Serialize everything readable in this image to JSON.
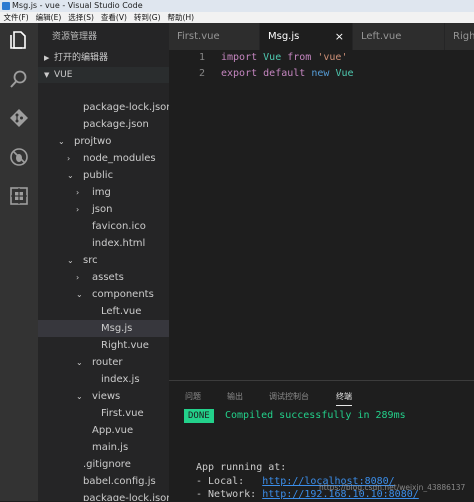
{
  "window": {
    "title": "Msg.js - vue - Visual Studio Code"
  },
  "menu": [
    "文件(F)",
    "编辑(E)",
    "选择(S)",
    "查看(V)",
    "转到(G)",
    "帮助(H)"
  ],
  "activity": [
    {
      "icon": "files-icon"
    },
    {
      "icon": "search-icon"
    },
    {
      "icon": "source-control-icon"
    },
    {
      "icon": "debug-icon"
    },
    {
      "icon": "extensions-icon"
    }
  ],
  "sidebar": {
    "title": "资源管理器",
    "open_editors": "打开的编辑器",
    "workspace": "VUE",
    "tree": [
      {
        "label": "package-lock.json",
        "indent": 1,
        "chev": ""
      },
      {
        "label": "package.json",
        "indent": 1,
        "chev": ""
      },
      {
        "label": "projtwo",
        "indent": 0,
        "chev": "down"
      },
      {
        "label": "node_modules",
        "indent": 1,
        "chev": "right"
      },
      {
        "label": "public",
        "indent": 1,
        "chev": "down"
      },
      {
        "label": "img",
        "indent": 2,
        "chev": "right"
      },
      {
        "label": "json",
        "indent": 2,
        "chev": "right"
      },
      {
        "label": "favicon.ico",
        "indent": 2,
        "chev": ""
      },
      {
        "label": "index.html",
        "indent": 2,
        "chev": ""
      },
      {
        "label": "src",
        "indent": 1,
        "chev": "down"
      },
      {
        "label": "assets",
        "indent": 2,
        "chev": "right"
      },
      {
        "label": "components",
        "indent": 2,
        "chev": "down"
      },
      {
        "label": "Left.vue",
        "indent": 3,
        "chev": ""
      },
      {
        "label": "Msg.js",
        "indent": 3,
        "chev": "",
        "selected": true
      },
      {
        "label": "Right.vue",
        "indent": 3,
        "chev": ""
      },
      {
        "label": "router",
        "indent": 2,
        "chev": "down"
      },
      {
        "label": "index.js",
        "indent": 3,
        "chev": ""
      },
      {
        "label": "views",
        "indent": 2,
        "chev": "down"
      },
      {
        "label": "First.vue",
        "indent": 3,
        "chev": ""
      },
      {
        "label": "App.vue",
        "indent": 2,
        "chev": ""
      },
      {
        "label": "main.js",
        "indent": 2,
        "chev": ""
      },
      {
        "label": ".gitignore",
        "indent": 1,
        "chev": ""
      },
      {
        "label": "babel.config.js",
        "indent": 1,
        "chev": ""
      },
      {
        "label": "package-lock.json",
        "indent": 1,
        "chev": ""
      },
      {
        "label": "package.json",
        "indent": 1,
        "chev": ""
      }
    ]
  },
  "tabs": [
    {
      "label": "First.vue",
      "active": false
    },
    {
      "label": "Msg.js",
      "active": true
    },
    {
      "label": "Left.vue",
      "active": false
    },
    {
      "label": "Righ",
      "active": false
    }
  ],
  "tab_close": "×",
  "code": {
    "lines": [
      {
        "num": "1",
        "tokens": [
          {
            "t": "import",
            "c": "kw2"
          },
          {
            "t": " ",
            "c": "pl"
          },
          {
            "t": "Vue",
            "c": "id"
          },
          {
            "t": " ",
            "c": "pl"
          },
          {
            "t": "from",
            "c": "kw2"
          },
          {
            "t": " ",
            "c": "pl"
          },
          {
            "t": "'vue'",
            "c": "str"
          }
        ]
      },
      {
        "num": "2",
        "tokens": [
          {
            "t": "export",
            "c": "kw2"
          },
          {
            "t": " ",
            "c": "pl"
          },
          {
            "t": "default",
            "c": "kw2"
          },
          {
            "t": " ",
            "c": "pl"
          },
          {
            "t": "new",
            "c": "kw"
          },
          {
            "t": " ",
            "c": "pl"
          },
          {
            "t": "Vue",
            "c": "id"
          }
        ]
      }
    ]
  },
  "panel": {
    "tabs": [
      "问题",
      "输出",
      "调试控制台",
      "终端"
    ],
    "active_tab": 3,
    "done": "DONE",
    "compiled": "Compiled successfully in 289ms",
    "app_running": "App running at:",
    "local_label": "- Local:   ",
    "local_url": "http://localhost:8080/",
    "network_label": "- Network: ",
    "network_url": "http://192.168.10.10:8080/"
  },
  "watermark": "https://blog.csdn.net/weixin_43886137",
  "colors": {
    "accent_green": "#23d18b",
    "link_blue": "#3b8eea",
    "activity_bg": "#333333",
    "sidebar_bg": "#252526",
    "editor_bg": "#1e1e1e"
  }
}
